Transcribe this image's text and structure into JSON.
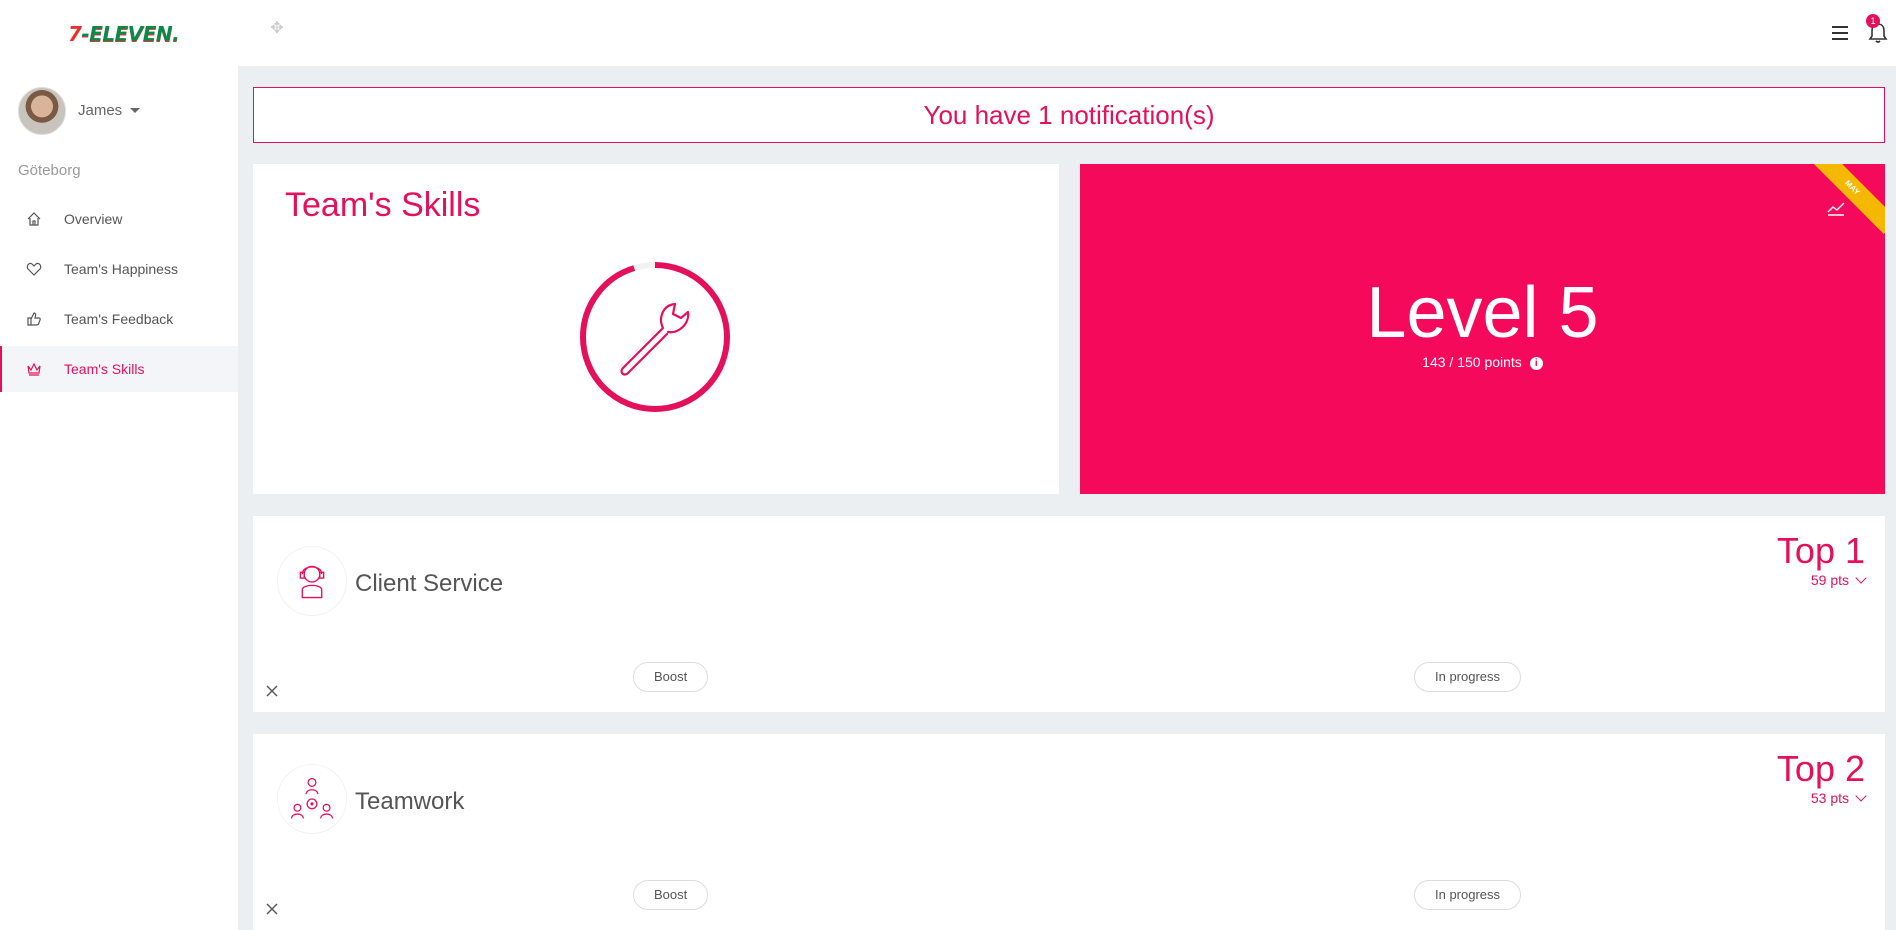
{
  "brand": {
    "logo_seven": "7",
    "logo_eleven": "-ELEVEN."
  },
  "header": {
    "notification_count": "1"
  },
  "sidebar": {
    "user_name": "James",
    "location": "Göteborg",
    "items": [
      {
        "label": "Overview",
        "icon": "home-icon"
      },
      {
        "label": "Team's Happiness",
        "icon": "heart-icon"
      },
      {
        "label": "Team's Feedback",
        "icon": "thumbs-up-icon"
      },
      {
        "label": "Team's Skills",
        "icon": "crown-icon"
      }
    ]
  },
  "notification": {
    "text": "You have 1 notification(s)"
  },
  "skills_card": {
    "title": "Team's Skills",
    "progress": 0.953
  },
  "level_card": {
    "title": "Level 5",
    "points": "143 / 150 points",
    "ribbon": "MAY",
    "background": "#f5095a",
    "ribbon_color": "#f5b800"
  },
  "skills": [
    {
      "name": "Client Service",
      "rank": "Top 1",
      "points": "59 pts",
      "boost_label": "Boost",
      "status_label": "In progress"
    },
    {
      "name": "Teamwork",
      "rank": "Top 2",
      "points": "53 pts",
      "boost_label": "Boost",
      "status_label": "In progress"
    }
  ],
  "colors": {
    "accent": "#e5105a"
  }
}
